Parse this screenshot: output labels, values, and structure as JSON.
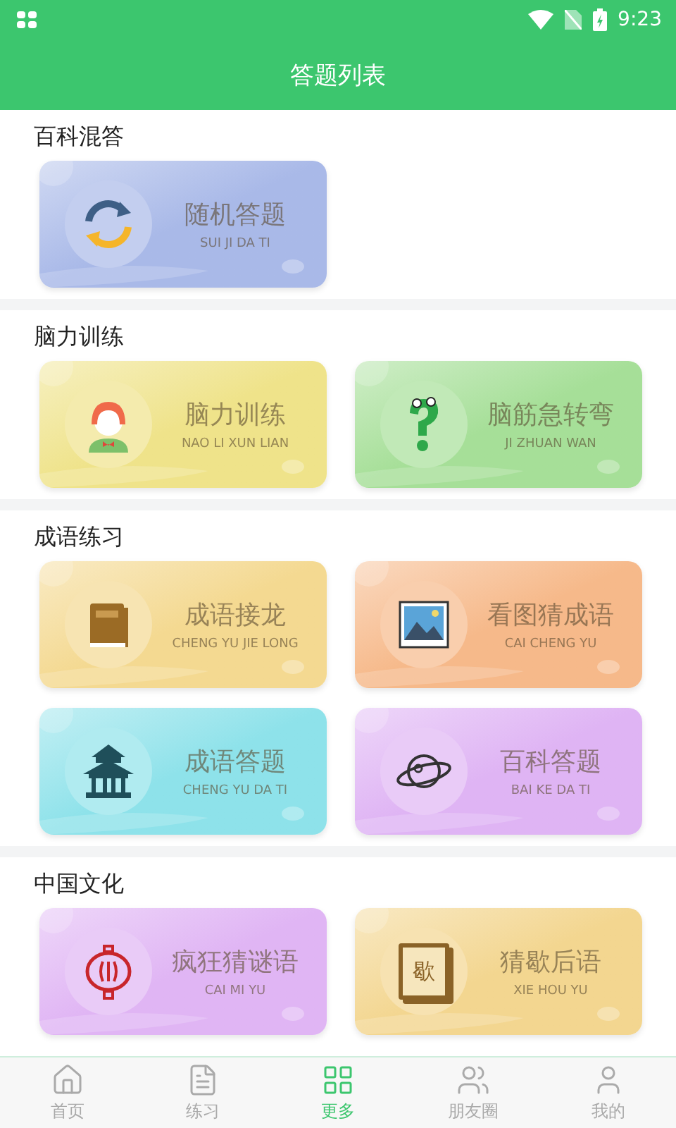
{
  "status_bar": {
    "time": "9:23"
  },
  "header": {
    "title": "答题列表"
  },
  "sections": [
    {
      "title": "百科混答",
      "cards": [
        {
          "title": "随机答题",
          "subtitle": "SUI JI DA TI",
          "kind": "refresh",
          "color": "#a9b9e8"
        }
      ]
    },
    {
      "title": "脑力训练",
      "cards": [
        {
          "title": "脑力训练",
          "subtitle": "NAO LI XUN LIAN",
          "kind": "girl",
          "color": "#efe38a"
        },
        {
          "title": "脑筋急转弯",
          "subtitle": "JI ZHUAN WAN",
          "kind": "question",
          "color": "#a6df98"
        }
      ]
    },
    {
      "title": "成语练习",
      "cards": [
        {
          "title": "成语接龙",
          "subtitle": "CHENG YU JIE LONG",
          "kind": "book",
          "color": "#f4d991"
        },
        {
          "title": "看图猜成语",
          "subtitle": "CAI CHENG YU",
          "kind": "picture",
          "color": "#f6b98a"
        },
        {
          "title": "成语答题",
          "subtitle": "CHENG YU DA TI",
          "kind": "pavilion",
          "color": "#8ee2ea"
        },
        {
          "title": "百科答题",
          "subtitle": "BAI KE DA TI",
          "kind": "planet",
          "color": "#dfb4f4"
        }
      ]
    },
    {
      "title": "中国文化",
      "cards": [
        {
          "title": "疯狂猜谜语",
          "subtitle": "CAI MI YU",
          "kind": "lantern",
          "color": "#e0b5f4"
        },
        {
          "title": "猜歇后语",
          "subtitle": "XIE HOU YU",
          "kind": "charbook",
          "glyph": "歇",
          "color": "#f3d690"
        }
      ]
    }
  ],
  "tabs": [
    {
      "label": "首页",
      "kind": "home",
      "selected": false
    },
    {
      "label": "练习",
      "kind": "note",
      "selected": false
    },
    {
      "label": "更多",
      "kind": "grid",
      "selected": true
    },
    {
      "label": "朋友圈",
      "kind": "people",
      "selected": false
    },
    {
      "label": "我的",
      "kind": "user",
      "selected": false
    }
  ]
}
